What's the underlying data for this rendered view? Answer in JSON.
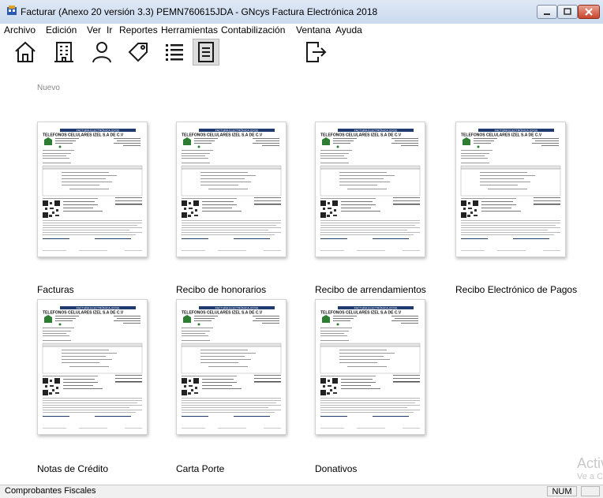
{
  "window": {
    "title": "Facturar (Anexo 20 versión 3.3) PEMN760615JDA - GNcys Factura Electrónica 2018"
  },
  "menu": [
    "Archivo",
    "Edición",
    "Ver",
    "Ir",
    "Reportes",
    "Herramientas",
    "Contabilización",
    "Ventana",
    "Ayuda"
  ],
  "toolbar": {
    "icons": [
      "home-icon",
      "building-icon",
      "person-icon",
      "tag-icon",
      "list-icon",
      "document-icon",
      "exit-icon"
    ]
  },
  "section_label": "Nuevo",
  "cards": [
    "Facturas",
    "Recibo de honorarios",
    "Recibo de arrendamientos",
    "Recibo Electrónico de Pagos",
    "Notas de Crédito",
    "Carta Porte",
    "Donativos"
  ],
  "invoice_preview": {
    "header": "FACTURA ELECTRÓNICA (CFDI)",
    "company": "TELEFONOS CELULARES IZEL S.A DE C.V"
  },
  "statusbar": {
    "text": "Comprobantes Fiscales",
    "num": "NUM"
  },
  "watermark": {
    "line1": "Activ",
    "line2": "Ve a Co"
  },
  "colors": {
    "invoice_header": "#1f3a6e",
    "accent_green": "#2e7d32"
  }
}
